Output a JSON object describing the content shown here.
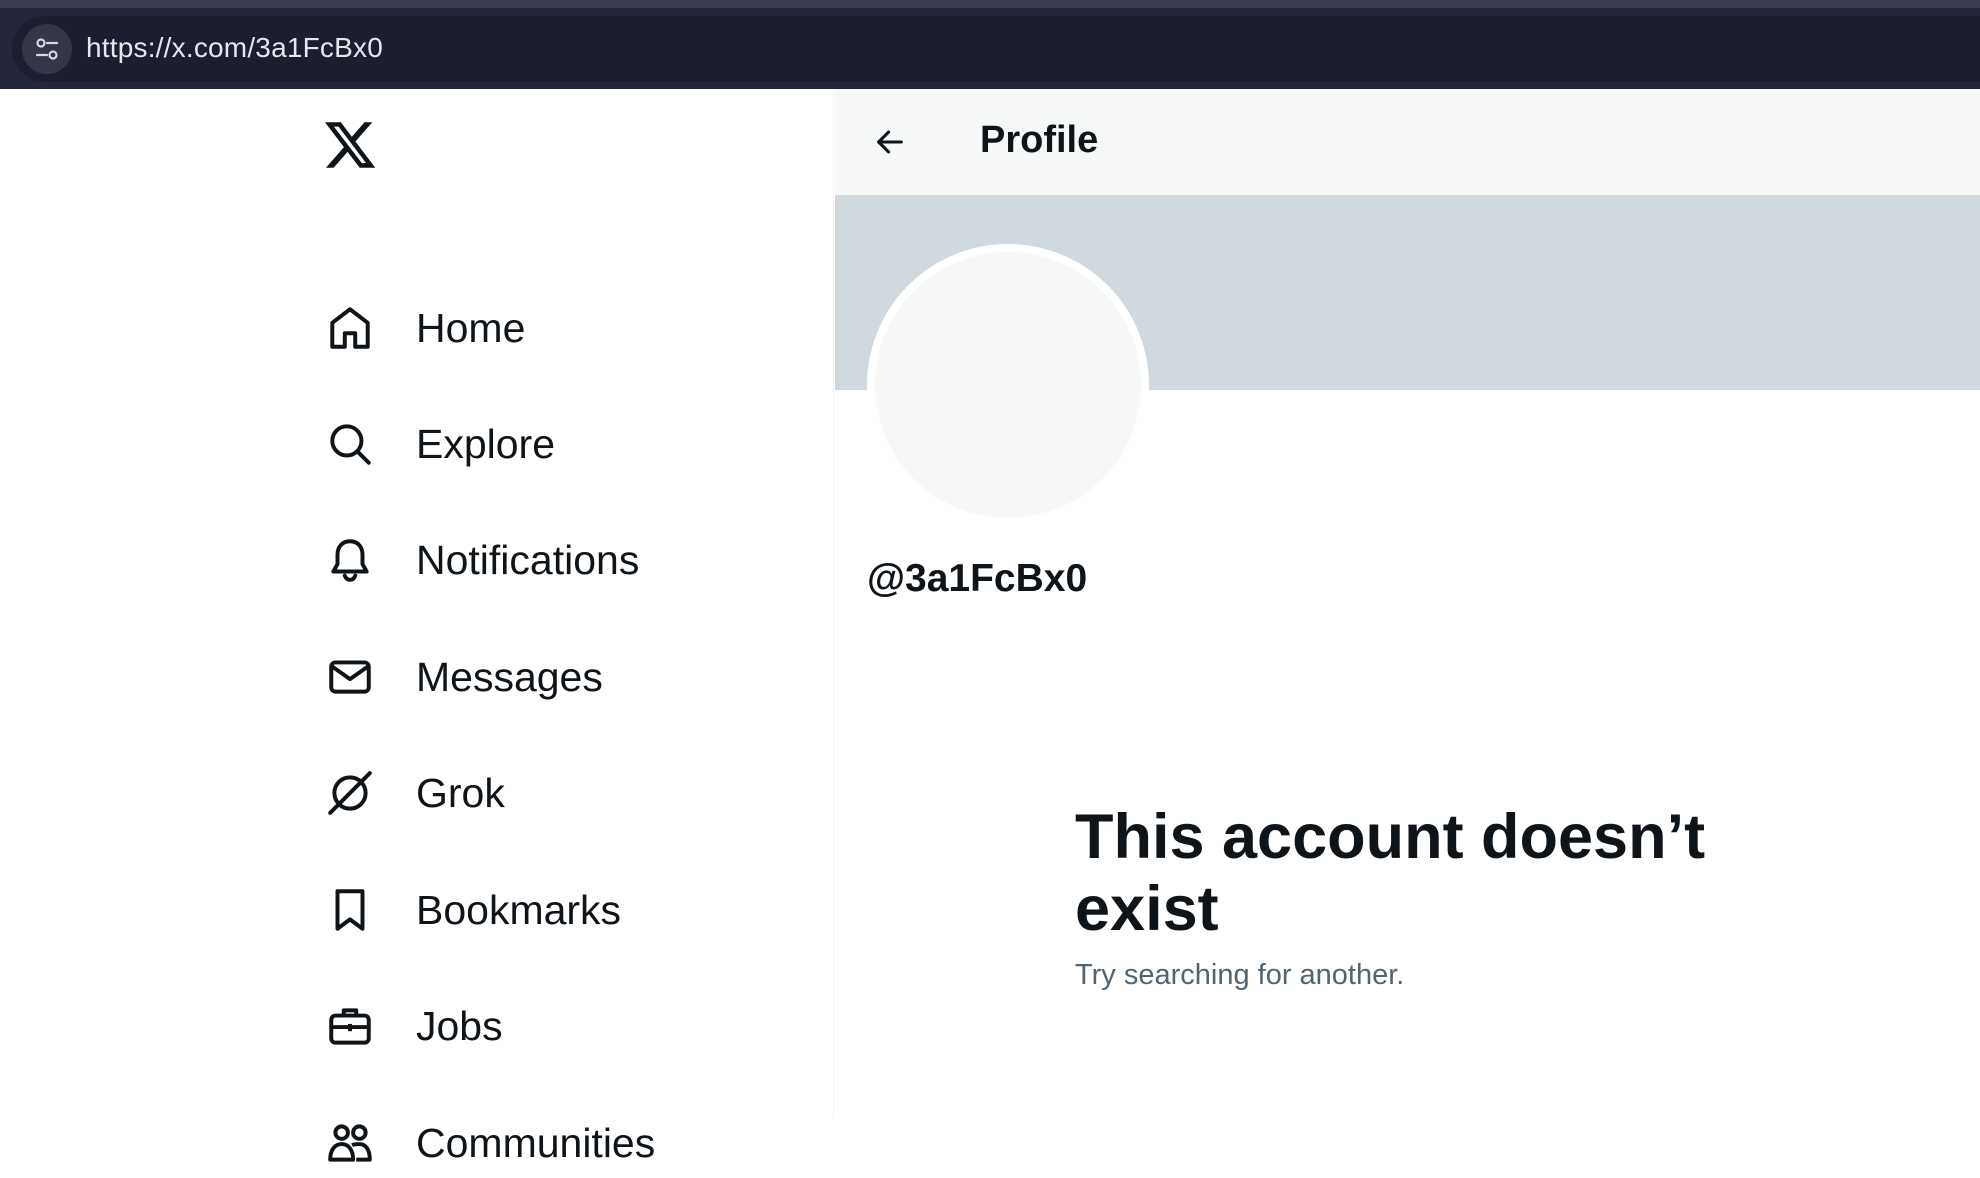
{
  "browser": {
    "url": "https://x.com/3a1FcBx0",
    "site_info_icon": "tune-icon"
  },
  "sidebar": {
    "logo": "x-logo",
    "items": [
      {
        "label": "Home",
        "icon": "home-icon"
      },
      {
        "label": "Explore",
        "icon": "search-icon"
      },
      {
        "label": "Notifications",
        "icon": "bell-icon"
      },
      {
        "label": "Messages",
        "icon": "envelope-icon"
      },
      {
        "label": "Grok",
        "icon": "grok-icon"
      },
      {
        "label": "Bookmarks",
        "icon": "bookmark-icon"
      },
      {
        "label": "Jobs",
        "icon": "briefcase-icon"
      },
      {
        "label": "Communities",
        "icon": "people-icon"
      }
    ]
  },
  "header": {
    "back_icon": "arrow-left-icon",
    "title": "Profile"
  },
  "profile": {
    "handle": "@3a1FcBx0",
    "banner_color": "#cfd9de",
    "avatar_color": "#f7f9f9"
  },
  "empty_state": {
    "title": "This account doesn’t exist",
    "subtitle": "Try searching for another."
  },
  "colors": {
    "text_primary": "#0f1419",
    "text_secondary": "#536471",
    "browser_bg": "#23253a"
  }
}
